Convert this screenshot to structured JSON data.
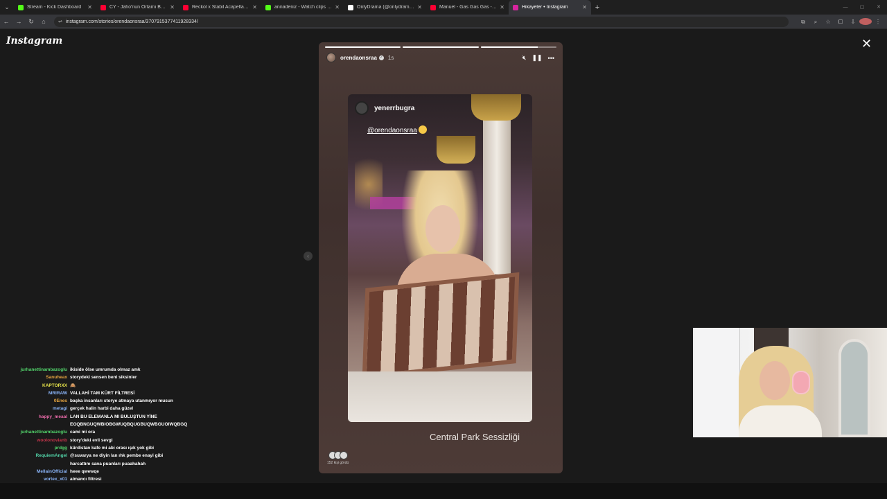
{
  "browser": {
    "tabs": [
      {
        "title": "Stream - Kick Dashboard",
        "color": "#53fc18"
      },
      {
        "title": "CY - Jaho'nun Ortamı Buysa Be",
        "color": "#ff0033"
      },
      {
        "title": "Reckol x Stabil Acapella (Lyrics)",
        "color": "#ff0033"
      },
      {
        "title": "annadeniz - Watch clips on Kick",
        "color": "#53fc18"
      },
      {
        "title": "OnlyDrama (@onlydramaX) / X",
        "color": "#ffffff"
      },
      {
        "title": "Manuel - Gas Gas Gas - YouTub",
        "color": "#ff0033"
      },
      {
        "title": "Hikayeler • Instagram",
        "color": "#d6249f",
        "active": true
      }
    ],
    "url": "instagram.com/stories/orendaonsraa/3707915377411928334/"
  },
  "instagram": {
    "logo": "Instagram"
  },
  "story": {
    "progress": [
      1,
      1,
      0.75
    ],
    "username": "orendaonsraa",
    "time": "1s",
    "repost_user": "yenerrbugra",
    "mention": "@orendaonsraa",
    "caption": "Central Park Sessizliği",
    "viewers_label": "152 kişi gördü"
  },
  "chat": [
    {
      "user": "jurhanettinambazoglu",
      "color": "#52d46b",
      "msg": "ikiside ölse umrumda olmaz amk"
    },
    {
      "user": "Sanuheax",
      "color": "#e8a640",
      "msg": "storydeki sensen beni siksinler"
    },
    {
      "user": "KAPTORXX",
      "color": "#e6e34a",
      "msg": "🙈"
    },
    {
      "user": "MRIRAW",
      "color": "#8ab4f8",
      "msg": "VALLAHİ TAM KÜRT FİLTRESİ"
    },
    {
      "user": "0Enes",
      "color": "#e8a640",
      "msg": "başka insanları storye atmaya utanmıyor musun"
    },
    {
      "user": "metagi",
      "color": "#8ab4f8",
      "msg": "gerçek halin harbi daha güzel"
    },
    {
      "user": "happy_meaal",
      "color": "#e86aa8",
      "msg": "LAN BU ELEMANLA MI BULUŞTUN YİNE EOQBNGUQWBIOBGWUQBQUGBUQWBGUOIWQBGQ"
    },
    {
      "user": "jurhanettinambazoglu",
      "color": "#52d46b",
      "msg": "cami mi ora"
    },
    {
      "user": "woolonovianb",
      "color": "#c4344a",
      "msg": "story'deki evli sevgi"
    },
    {
      "user": "prdgg",
      "color": "#52d46b",
      "msg": "kürdistan kafe mi abi orası ışık yok gibi"
    },
    {
      "user": "RequiemAngel",
      "color": "#52d4a8",
      "msg": "@suvarya ne diyin lan ıhk pembe enayi gibi harcattım sana puanları puaahahah"
    },
    {
      "user": "MellainOfficial",
      "color": "#8ab4f8",
      "msg": "heee qwewqe"
    },
    {
      "user": "vortex_x01",
      "color": "#8ab4f8",
      "msg": "almancı filtresi"
    }
  ]
}
